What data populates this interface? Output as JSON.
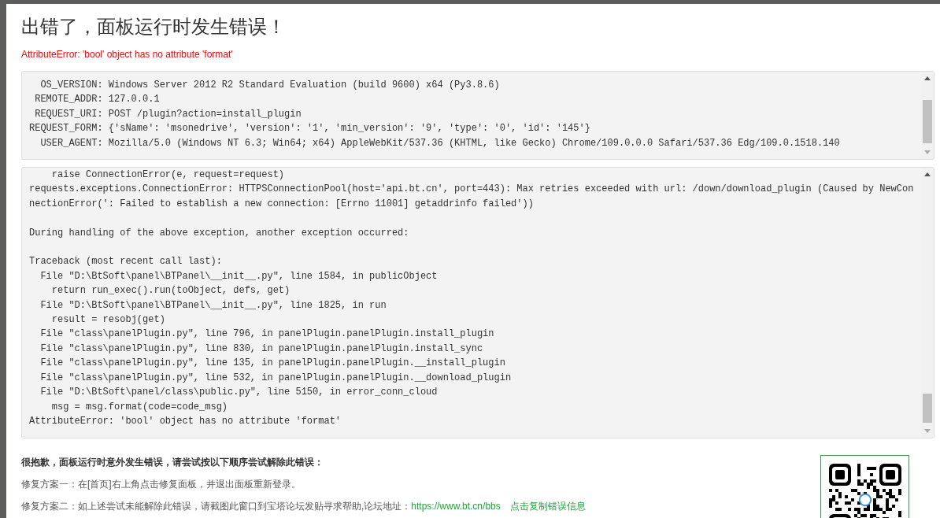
{
  "title": "出错了，面板运行时发生错误！",
  "error_summary": "AttributeError: 'bool' object has no attribute 'format'",
  "info_panel": {
    "text": "  OS_VERSION: Windows Server 2012 R2 Standard Evaluation (build 9600) x64 (Py3.8.6)\n REMOTE_ADDR: 127.0.0.1\n REQUEST_URI: POST /plugin?action=install_plugin\nREQUEST_FORM: {'sName': 'msonedrive', 'version': '1', 'min_version': '9', 'type': '0', 'id': '145'}\n  USER_AGENT: Mozilla/5.0 (Windows NT 6.3; Win64; x64) AppleWebKit/537.36 (KHTML, like Gecko) Chrome/109.0.0.0 Safari/537.36 Edg/109.0.1518.140"
  },
  "traceback_panel": {
    "text": "    raise ConnectionError(e, request=request)\nrequests.exceptions.ConnectionError: HTTPSConnectionPool(host='api.bt.cn', port=443): Max retries exceeded with url: /down/download_plugin (Caused by NewConnectionError(': Failed to establish a new connection: [Errno 11001] getaddrinfo failed'))\n\nDuring handling of the above exception, another exception occurred:\n\nTraceback (most recent call last):\n  File \"D:\\BtSoft\\panel\\BTPanel\\__init__.py\", line 1584, in publicObject\n    return run_exec().run(toObject, defs, get)\n  File \"D:\\BtSoft\\panel\\BTPanel\\__init__.py\", line 1825, in run\n    result = resobj(get)\n  File \"class\\panelPlugin.py\", line 796, in panelPlugin.panelPlugin.install_plugin\n  File \"class\\panelPlugin.py\", line 830, in panelPlugin.panelPlugin.install_sync\n  File \"class\\panelPlugin.py\", line 135, in panelPlugin.panelPlugin.__install_plugin\n  File \"class\\panelPlugin.py\", line 532, in panelPlugin.panelPlugin.__download_plugin\n  File \"D:\\BtSoft\\panel/class\\public.py\", line 5150, in error_conn_cloud\n    msg = msg.format(code=code_msg)\nAttributeError: 'bool' object has no attribute 'format'"
  },
  "help": {
    "heading": "很抱歉，面板运行时意外发生错误，请尝试按以下顺序尝试解除此错误：",
    "steps": [
      {
        "text": "修复方案一：在[首页]右上角点击修复面板，并退出面板重新登录。"
      },
      {
        "text": "修复方案二：如上述尝试未能解除此错误，请截图此窗口到宝塔论坛发贴寻求帮助,论坛地址：",
        "link": "https://www.bt.cn/bbs",
        "action": "点击复制错误信息"
      }
    ]
  }
}
